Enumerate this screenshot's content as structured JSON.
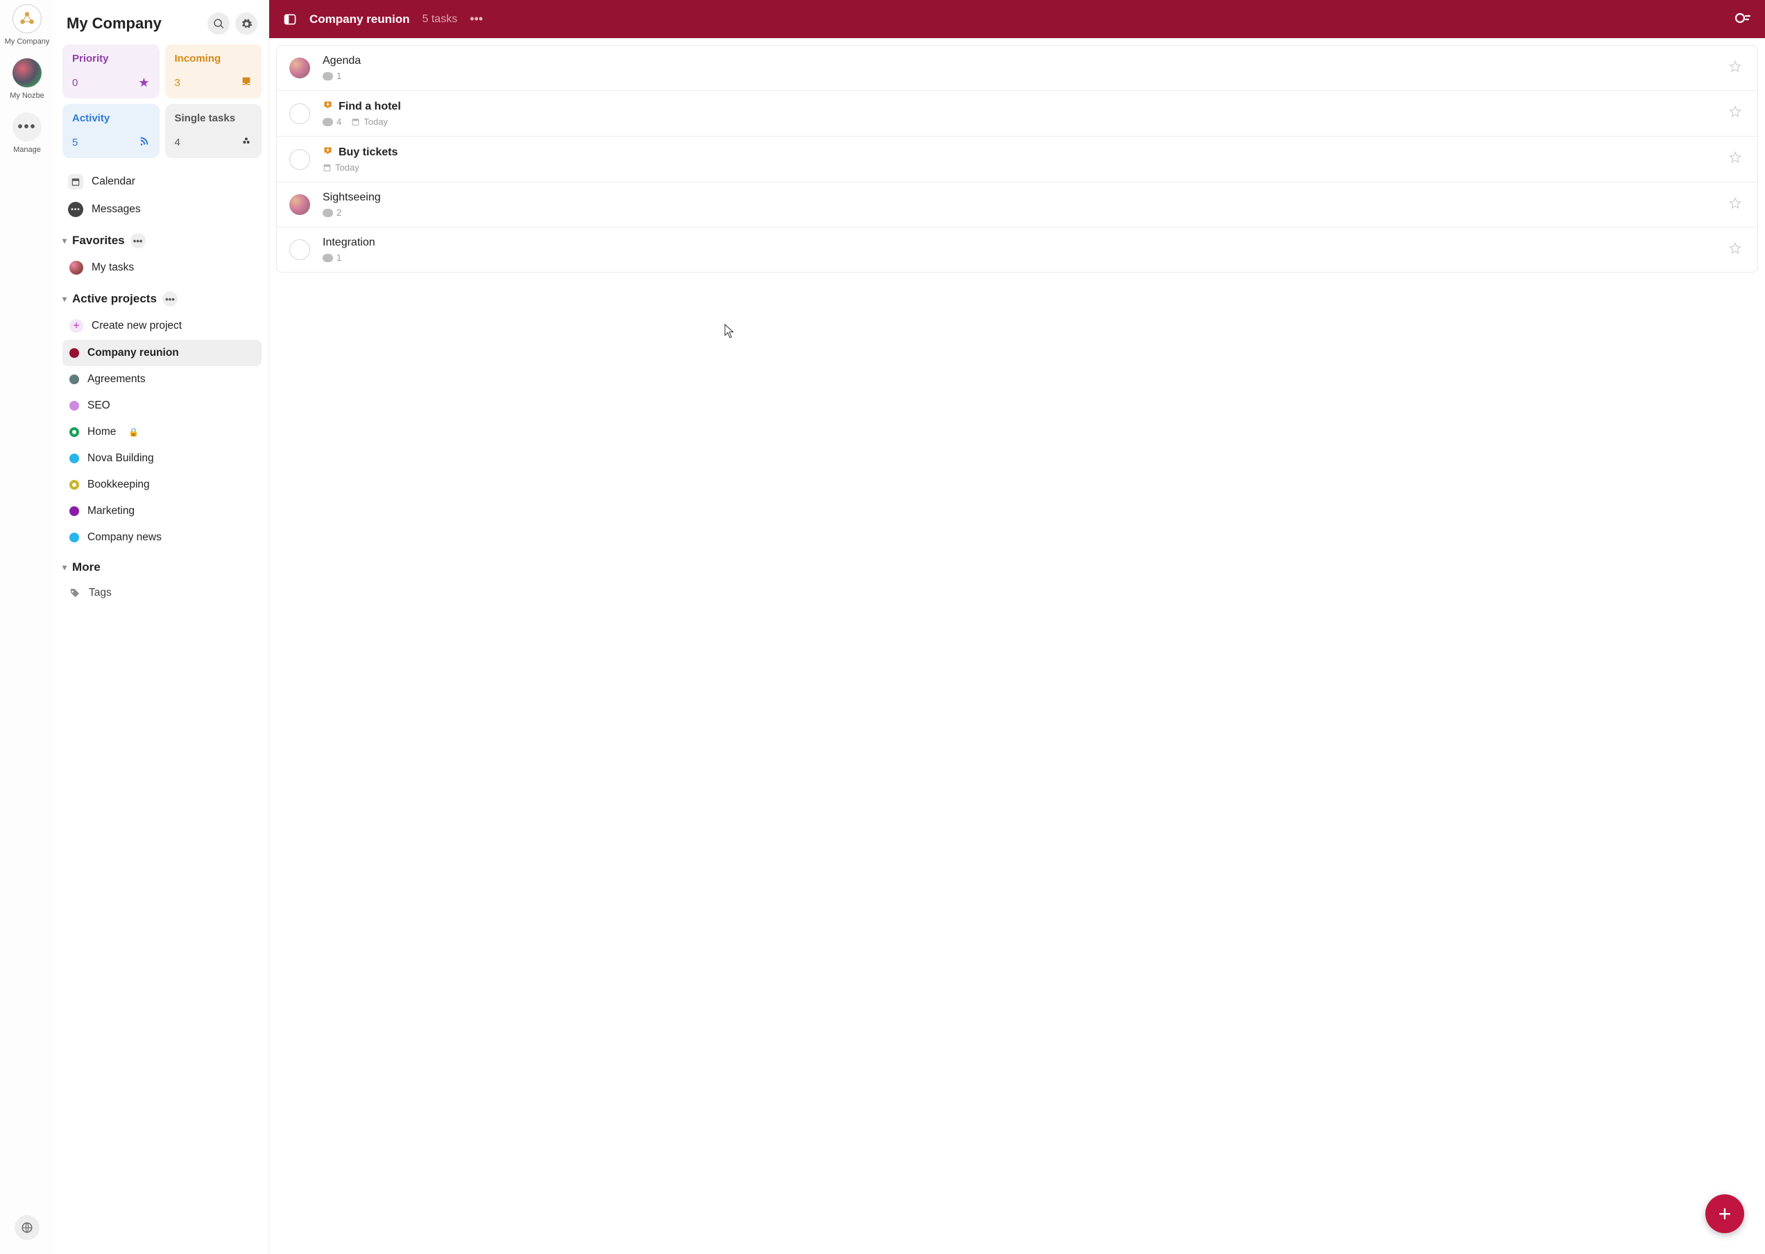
{
  "rail": {
    "company_label": "My Company",
    "mynozbe_label": "My Nozbe",
    "manage_label": "Manage"
  },
  "sidebar": {
    "title": "My Company",
    "cards": {
      "priority": {
        "title": "Priority",
        "count": "0"
      },
      "incoming": {
        "title": "Incoming",
        "count": "3"
      },
      "activity": {
        "title": "Activity",
        "count": "5"
      },
      "single": {
        "title": "Single tasks",
        "count": "4"
      }
    },
    "calendar_label": "Calendar",
    "messages_label": "Messages",
    "favorites_label": "Favorites",
    "favorites": [
      {
        "label": "My tasks"
      }
    ],
    "active_label": "Active projects",
    "create_label": "Create new project",
    "projects": [
      {
        "label": "Company reunion",
        "color": "#951233",
        "active": true,
        "locked": false
      },
      {
        "label": "Agreements",
        "color": "#5f7b7b",
        "active": false,
        "locked": false
      },
      {
        "label": "SEO",
        "color": "#cb8be0",
        "active": false,
        "locked": false
      },
      {
        "label": "Home",
        "color": "#17a05a",
        "active": false,
        "locked": true,
        "ring": true
      },
      {
        "label": "Nova Building",
        "color": "#27b5ea",
        "active": false,
        "locked": false
      },
      {
        "label": "Bookkeeping",
        "color": "#c9b32c",
        "active": false,
        "locked": false,
        "ring": true
      },
      {
        "label": "Marketing",
        "color": "#8c1aa9",
        "active": false,
        "locked": false
      },
      {
        "label": "Company news",
        "color": "#27b5ea",
        "active": false,
        "locked": false
      }
    ],
    "more_label": "More",
    "tags_label": "Tags"
  },
  "header": {
    "title": "Company reunion",
    "subtitle": "5 tasks"
  },
  "tasks": [
    {
      "title": "Agenda",
      "bold": false,
      "incoming": false,
      "avatar": true,
      "comments": "1",
      "date": ""
    },
    {
      "title": "Find a hotel",
      "bold": true,
      "incoming": true,
      "avatar": false,
      "comments": "4",
      "date": "Today"
    },
    {
      "title": "Buy tickets",
      "bold": true,
      "incoming": true,
      "avatar": false,
      "comments": "",
      "date": "Today"
    },
    {
      "title": "Sightseeing",
      "bold": false,
      "incoming": false,
      "avatar": true,
      "comments": "2",
      "date": ""
    },
    {
      "title": "Integration",
      "bold": false,
      "incoming": false,
      "avatar": false,
      "comments": "1",
      "date": ""
    }
  ],
  "colors": {
    "header_bg": "#951233",
    "fab_bg": "#c01540"
  }
}
